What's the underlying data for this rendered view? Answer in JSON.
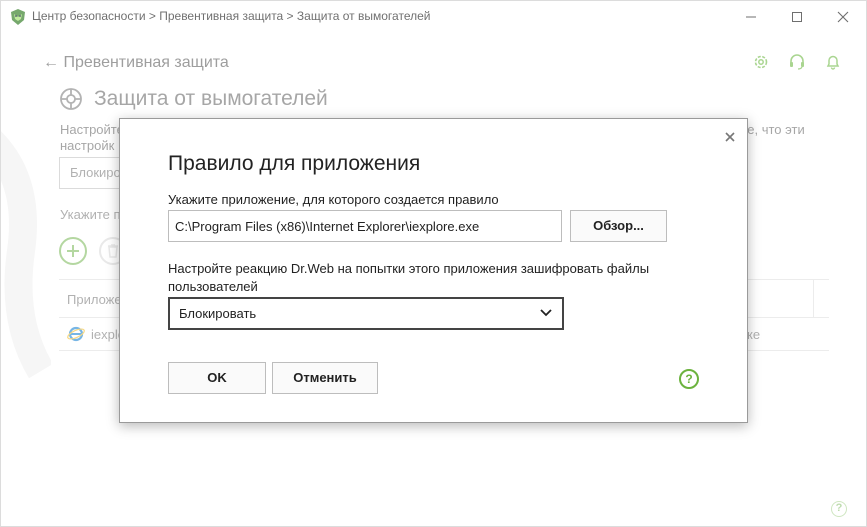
{
  "window": {
    "title": "Центр безопасности > Превентивная защита > Защита от вымогателей",
    "icons": [
      "drweb-logo-icon",
      "minimize-icon",
      "maximize-icon",
      "close-icon"
    ]
  },
  "header": {
    "icons": [
      "gear-icon",
      "headset-icon",
      "bell-icon"
    ]
  },
  "page": {
    "back_label": "Превентивная защита",
    "title": "Защита от вымогателей",
    "desc_left_1": "Настройте",
    "desc_right_1": "ие, что эти",
    "desc_left_2": "настройк",
    "select_value": "Блокиро",
    "apps_label": "Укажите п",
    "table": {
      "column_app": "Приложе",
      "row_app": "iexplo",
      "row_reaction": "ке"
    },
    "help": "?"
  },
  "dialog": {
    "title": "Правило для приложения",
    "app_label": "Укажите приложение, для которого создается правило",
    "app_path": "C:\\Program Files (x86)\\Internet Explorer\\iexplore.exe",
    "browse_label": "Обзор...",
    "reaction_label": "Настройте реакцию Dr.Web на попытки этого приложения зашифровать файлы пользователей",
    "reaction_value": "Блокировать",
    "ok_label": "OK",
    "cancel_label": "Отменить",
    "help": "?"
  },
  "colors": {
    "accent_green": "#6cb33f",
    "dialog_border": "#9a9a9a"
  }
}
